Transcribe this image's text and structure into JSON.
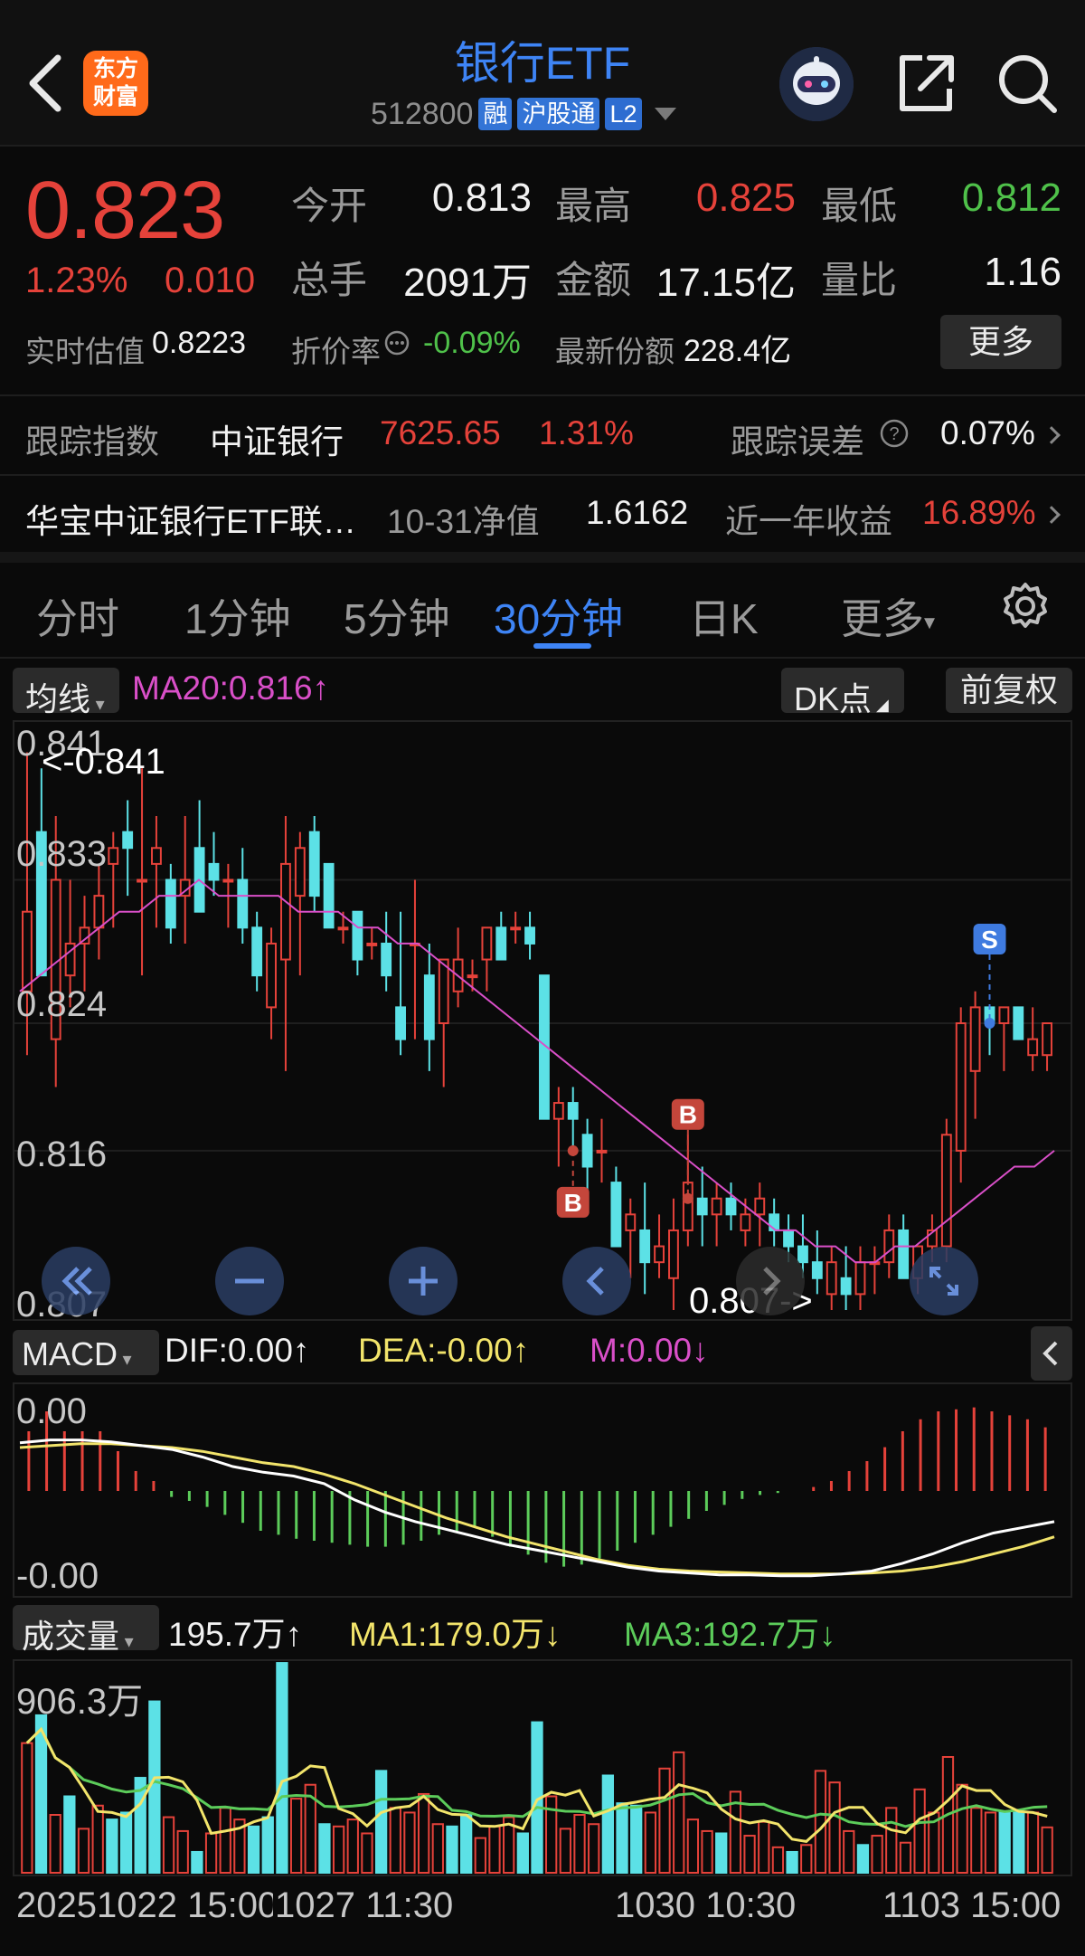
{
  "header": {
    "logo_line1": "东方",
    "logo_line2": "财富",
    "title": "银行ETF",
    "code": "512800",
    "tags": [
      "融",
      "沪股通",
      "L2"
    ]
  },
  "quote": {
    "price": "0.823",
    "change_pct": "1.23%",
    "change_abs": "0.010",
    "open_label": "今开",
    "open": "0.813",
    "high_label": "最高",
    "high": "0.825",
    "low_label": "最低",
    "low": "0.812",
    "vol_label": "总手",
    "vol": "2091万",
    "amount_label": "金额",
    "amount": "17.15亿",
    "ratio_label": "量比",
    "ratio": "1.16",
    "est_label": "实时估值",
    "est": "0.8223",
    "discount_label": "折价率",
    "discount": "-0.09%",
    "shares_label": "最新份额",
    "shares": "228.4亿",
    "more": "更多"
  },
  "tracking": {
    "label": "跟踪指数",
    "index": "中证银行",
    "value": "7625.65",
    "pct": "1.31%",
    "err_label": "跟踪误差",
    "err": "0.07%"
  },
  "fund": {
    "name": "华宝中证银行ETF联…",
    "nav_label": "10-31净值",
    "nav": "1.6162",
    "ret_label": "近一年收益",
    "ret": "16.89%"
  },
  "tabs": [
    "分时",
    "1分钟",
    "5分钟",
    "30分钟",
    "日K",
    "更多"
  ],
  "active_tab": 3,
  "main_chart": {
    "ma_selector": "均线",
    "ma20": "MA20:0.816↑",
    "dk_btn": "DK点",
    "adjust_btn": "前复权",
    "y_ticks": [
      "0.841",
      "0.833",
      "0.824",
      "0.816",
      "0.807"
    ],
    "max_label": "<-0.841",
    "min_label": "0.807->",
    "signals": [
      "S",
      "B",
      "B"
    ]
  },
  "macd": {
    "selector": "MACD",
    "dif": "DIF:0.00↑",
    "dea": "DEA:-0.00↑",
    "m": "M:0.00↓",
    "y_top": "0.00",
    "y_bottom": "-0.00"
  },
  "volume": {
    "selector": "成交量",
    "current": "195.7万↑",
    "ma1": "MA1:179.0万↓",
    "ma3": "MA3:192.7万↓",
    "y_top": "906.3万"
  },
  "x_axis": [
    "20251022 15:00",
    "1027 11:30",
    "1030 10:30",
    "1103 15:00"
  ],
  "colors": {
    "up": "#e5423a",
    "down": "#5ce1e6",
    "ma20": "#d94fc8",
    "accent": "#3e84f5"
  },
  "chart_data": {
    "type": "candlestick",
    "ohlc": [
      [
        0.826,
        0.841,
        0.822,
        0.831
      ],
      [
        0.836,
        0.84,
        0.827,
        0.827
      ],
      [
        0.823,
        0.837,
        0.82,
        0.833
      ],
      [
        0.827,
        0.833,
        0.825,
        0.829
      ],
      [
        0.829,
        0.832,
        0.826,
        0.83
      ],
      [
        0.83,
        0.834,
        0.828,
        0.832
      ],
      [
        0.834,
        0.836,
        0.83,
        0.835
      ],
      [
        0.836,
        0.838,
        0.832,
        0.835
      ],
      [
        0.833,
        0.84,
        0.827,
        0.833
      ],
      [
        0.834,
        0.837,
        0.83,
        0.835
      ],
      [
        0.833,
        0.834,
        0.829,
        0.83
      ],
      [
        0.832,
        0.837,
        0.829,
        0.833
      ],
      [
        0.835,
        0.838,
        0.831,
        0.831
      ],
      [
        0.834,
        0.836,
        0.832,
        0.833
      ],
      [
        0.833,
        0.834,
        0.83,
        0.833
      ],
      [
        0.833,
        0.835,
        0.829,
        0.83
      ],
      [
        0.83,
        0.831,
        0.826,
        0.827
      ],
      [
        0.825,
        0.83,
        0.823,
        0.829
      ],
      [
        0.828,
        0.837,
        0.821,
        0.834
      ],
      [
        0.832,
        0.836,
        0.827,
        0.835
      ],
      [
        0.836,
        0.837,
        0.831,
        0.832
      ],
      [
        0.834,
        0.834,
        0.83,
        0.83
      ],
      [
        0.83,
        0.831,
        0.829,
        0.83
      ],
      [
        0.831,
        0.831,
        0.827,
        0.828
      ],
      [
        0.829,
        0.83,
        0.828,
        0.829
      ],
      [
        0.829,
        0.831,
        0.826,
        0.827
      ],
      [
        0.825,
        0.831,
        0.822,
        0.823
      ],
      [
        0.829,
        0.833,
        0.823,
        0.829
      ],
      [
        0.827,
        0.829,
        0.821,
        0.823
      ],
      [
        0.824,
        0.828,
        0.82,
        0.828
      ],
      [
        0.826,
        0.83,
        0.825,
        0.828
      ],
      [
        0.827,
        0.828,
        0.826,
        0.827
      ],
      [
        0.828,
        0.83,
        0.826,
        0.83
      ],
      [
        0.83,
        0.831,
        0.828,
        0.828
      ],
      [
        0.83,
        0.831,
        0.829,
        0.83
      ],
      [
        0.83,
        0.831,
        0.828,
        0.829
      ],
      [
        0.827,
        0.827,
        0.818,
        0.818
      ],
      [
        0.818,
        0.82,
        0.815,
        0.819
      ],
      [
        0.819,
        0.82,
        0.816,
        0.818
      ],
      [
        0.817,
        0.818,
        0.812,
        0.815
      ],
      [
        0.816,
        0.818,
        0.814,
        0.816
      ],
      [
        0.814,
        0.815,
        0.81,
        0.81
      ],
      [
        0.811,
        0.813,
        0.808,
        0.812
      ],
      [
        0.811,
        0.814,
        0.807,
        0.809
      ],
      [
        0.809,
        0.812,
        0.808,
        0.81
      ],
      [
        0.808,
        0.813,
        0.806,
        0.811
      ],
      [
        0.811,
        0.817,
        0.81,
        0.814
      ],
      [
        0.813,
        0.815,
        0.81,
        0.812
      ],
      [
        0.812,
        0.814,
        0.81,
        0.813
      ],
      [
        0.813,
        0.814,
        0.811,
        0.812
      ],
      [
        0.811,
        0.813,
        0.81,
        0.812
      ],
      [
        0.812,
        0.814,
        0.81,
        0.813
      ],
      [
        0.812,
        0.813,
        0.81,
        0.811
      ],
      [
        0.811,
        0.812,
        0.809,
        0.81
      ],
      [
        0.81,
        0.812,
        0.808,
        0.809
      ],
      [
        0.809,
        0.811,
        0.807,
        0.808
      ],
      [
        0.807,
        0.81,
        0.806,
        0.809
      ],
      [
        0.808,
        0.81,
        0.806,
        0.807
      ],
      [
        0.807,
        0.81,
        0.806,
        0.809
      ],
      [
        0.809,
        0.81,
        0.807,
        0.809
      ],
      [
        0.809,
        0.812,
        0.808,
        0.811
      ],
      [
        0.811,
        0.812,
        0.808,
        0.808
      ],
      [
        0.808,
        0.81,
        0.807,
        0.81
      ],
      [
        0.81,
        0.812,
        0.809,
        0.811
      ],
      [
        0.81,
        0.818,
        0.809,
        0.817
      ],
      [
        0.816,
        0.825,
        0.814,
        0.824
      ],
      [
        0.821,
        0.826,
        0.818,
        0.825
      ],
      [
        0.825,
        0.825,
        0.822,
        0.824
      ],
      [
        0.824,
        0.825,
        0.821,
        0.825
      ],
      [
        0.825,
        0.825,
        0.823,
        0.823
      ],
      [
        0.822,
        0.825,
        0.821,
        0.823
      ],
      [
        0.822,
        0.824,
        0.821,
        0.824
      ]
    ],
    "ma20": [
      0.826,
      0.827,
      0.828,
      0.829,
      0.83,
      0.831,
      0.831,
      0.832,
      0.832,
      0.833,
      0.832,
      0.832,
      0.832,
      0.832,
      0.831,
      0.831,
      0.831,
      0.83,
      0.83,
      0.829,
      0.829,
      0.828,
      0.827,
      0.826,
      0.825,
      0.824,
      0.823,
      0.822,
      0.821,
      0.82,
      0.819,
      0.818,
      0.817,
      0.816,
      0.815,
      0.814,
      0.813,
      0.812,
      0.811,
      0.811,
      0.81,
      0.81,
      0.809,
      0.809,
      0.81,
      0.81,
      0.811,
      0.812,
      0.813,
      0.814,
      0.815,
      0.815,
      0.816
    ],
    "macd_hist": [
      3,
      4,
      3,
      3,
      3,
      2,
      1,
      0.5,
      -0.3,
      -0.5,
      -0.8,
      -1.2,
      -1.6,
      -2,
      -2.2,
      -2.4,
      -2.5,
      -2.6,
      -2.7,
      -2.8,
      -2.8,
      -2.7,
      -2.5,
      -2.2,
      -2,
      -1.8,
      -2.3,
      -2.8,
      -3.2,
      -3.6,
      -3.8,
      -3.7,
      -3.4,
      -3,
      -2.6,
      -2.2,
      -1.8,
      -1.4,
      -1,
      -0.7,
      -0.4,
      -0.2,
      -0.1,
      0,
      0.2,
      0.5,
      1,
      1.5,
      2.2,
      3,
      3.6,
      4,
      4.1,
      4.2,
      4.0,
      3.8,
      3.6,
      3.2
    ],
    "dif": [
      4.5,
      4.8,
      4.8,
      4.6,
      4.2,
      3.8,
      3.0,
      2.0,
      1.4,
      1.0,
      0.2,
      -1.5,
      -2.8,
      -3.8,
      -4.6,
      -5.4,
      -6.2,
      -6.8,
      -7.4,
      -8.0,
      -8.6,
      -9.0,
      -9.2,
      -9.4,
      -9.4,
      -9.5,
      -9.5,
      -9.3,
      -9.0,
      -8.2,
      -7.2,
      -6.0,
      -5.0,
      -4.4,
      -3.8
    ],
    "dea": [
      4.0,
      4.2,
      4.4,
      4.4,
      4.2,
      4.0,
      3.6,
      3.0,
      2.4,
      2.0,
      1.2,
      0.2,
      -1.0,
      -2.2,
      -3.4,
      -4.4,
      -5.4,
      -6.2,
      -7.0,
      -7.8,
      -8.4,
      -8.8,
      -9.0,
      -9.1,
      -9.2,
      -9.3,
      -9.3,
      -9.3,
      -9.2,
      -9.0,
      -8.6,
      -8.0,
      -7.2,
      -6.4,
      -5.4
    ],
    "volume": [
      [
        560,
        1
      ],
      [
        680,
        0
      ],
      [
        250,
        1
      ],
      [
        330,
        0
      ],
      [
        190,
        1
      ],
      [
        290,
        1
      ],
      [
        230,
        0
      ],
      [
        260,
        0
      ],
      [
        410,
        0
      ],
      [
        740,
        0
      ],
      [
        240,
        1
      ],
      [
        180,
        1
      ],
      [
        90,
        0
      ],
      [
        170,
        1
      ],
      [
        280,
        1
      ],
      [
        230,
        1
      ],
      [
        200,
        0
      ],
      [
        240,
        0
      ],
      [
        906,
        0
      ],
      [
        320,
        1
      ],
      [
        380,
        1
      ],
      [
        210,
        0
      ],
      [
        200,
        1
      ],
      [
        230,
        1
      ],
      [
        170,
        1
      ],
      [
        440,
        0
      ],
      [
        280,
        1
      ],
      [
        260,
        1
      ],
      [
        340,
        1
      ],
      [
        210,
        1
      ],
      [
        200,
        0
      ],
      [
        250,
        0
      ],
      [
        150,
        1
      ],
      [
        200,
        1
      ],
      [
        240,
        1
      ],
      [
        170,
        0
      ],
      [
        650,
        0
      ],
      [
        330,
        1
      ],
      [
        190,
        1
      ],
      [
        250,
        1
      ],
      [
        210,
        1
      ],
      [
        420,
        0
      ],
      [
        300,
        0
      ],
      [
        290,
        0
      ],
      [
        260,
        1
      ],
      [
        450,
        1
      ],
      [
        520,
        1
      ],
      [
        230,
        1
      ],
      [
        180,
        1
      ],
      [
        170,
        0
      ],
      [
        350,
        1
      ],
      [
        160,
        1
      ],
      [
        220,
        1
      ],
      [
        110,
        1
      ],
      [
        90,
        0
      ],
      [
        120,
        1
      ],
      [
        440,
        1
      ],
      [
        390,
        1
      ],
      [
        180,
        1
      ],
      [
        120,
        0
      ],
      [
        160,
        1
      ],
      [
        280,
        1
      ],
      [
        130,
        1
      ],
      [
        360,
        1
      ],
      [
        260,
        1
      ],
      [
        500,
        1
      ],
      [
        380,
        1
      ],
      [
        280,
        1
      ],
      [
        260,
        1
      ],
      [
        260,
        0
      ],
      [
        260,
        0
      ],
      [
        260,
        1
      ],
      [
        196,
        1
      ]
    ]
  }
}
